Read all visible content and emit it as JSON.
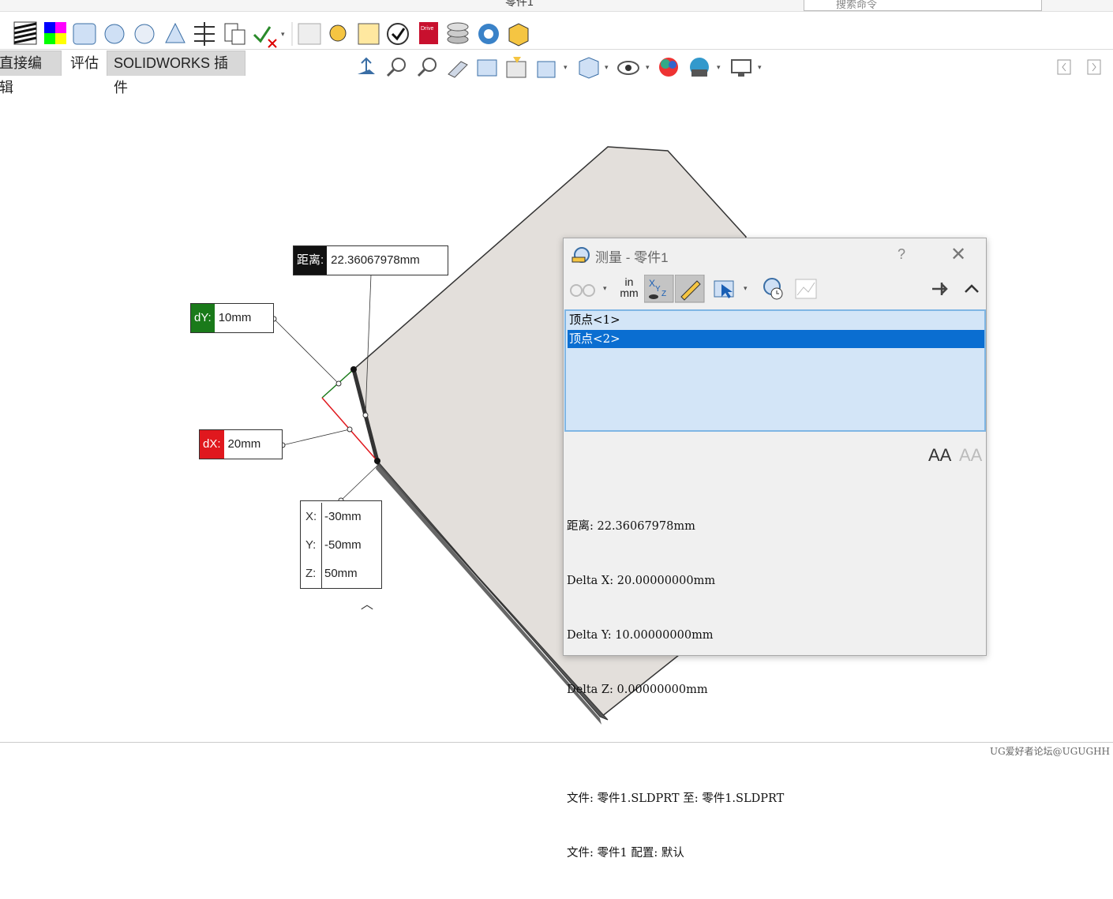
{
  "window": {
    "title": "零件1"
  },
  "search": {
    "placeholder": "搜索命令"
  },
  "tabs": [
    {
      "label": "直接编辑",
      "active": true
    },
    {
      "label": "评估",
      "active": false
    },
    {
      "label": "SOLIDWORKS 插件",
      "active": true
    }
  ],
  "toolbar_icons": [
    "zebra-stripes-icon",
    "curvature-icon",
    "deviation-analysis-icon",
    "draft-analysis-icon",
    "undercut-analysis-icon",
    "parting-line-icon",
    "thickness-icon",
    "interference-icon",
    "check-icon",
    "geometry-analysis-icon",
    "import-diagnostics-icon",
    "simulation-icon",
    "feature-check-icon",
    "driveworks-icon",
    "costing-icon",
    "sustainability-icon",
    "design-checker-icon"
  ],
  "view_icons": [
    "view-orientation-icon",
    "zoom-to-fit-icon",
    "zoom-area-icon",
    "previous-view-icon",
    "section-view-icon",
    "dynamic-annotation-icon",
    "view-orientation-icon",
    "display-style-icon",
    "hide-show-icon",
    "edit-appearance-icon",
    "scene-icon",
    "view-settings-icon"
  ],
  "callouts": {
    "distance": {
      "label": "距离:",
      "value": "22.36067978mm"
    },
    "dy": {
      "label": "dY:",
      "value": "10mm",
      "color": "#1a7a1a"
    },
    "dx": {
      "label": "dX:",
      "value": "20mm",
      "color": "#e0181e"
    },
    "coords": [
      {
        "axis": "X:",
        "value": "-30mm"
      },
      {
        "axis": "Y:",
        "value": "-50mm"
      },
      {
        "axis": "Z:",
        "value": "50mm"
      }
    ]
  },
  "measure_dialog": {
    "title": "测量 - 零件1",
    "help": "?",
    "close": "✕",
    "units_label_top": "in",
    "units_label_bottom": "mm",
    "selections": [
      {
        "label": "顶点<1>",
        "selected": false
      },
      {
        "label": "顶点<2>",
        "selected": true
      }
    ],
    "font_larger": "AA",
    "font_smaller": "AA",
    "results": [
      "距离: 22.36067978mm",
      "Delta X: 20.00000000mm",
      "Delta Y: 10.00000000mm",
      "Delta Z: 0.00000000mm",
      "",
      "文件: 零件1.SLDPRT 至: 零件1.SLDPRT",
      "文件: 零件1 配置: 默认"
    ]
  },
  "statusbar": {
    "watermark": "UG爱好者论坛@UGUGHH"
  },
  "colors": {
    "accent": "#0a6ed1",
    "list_bg": "#d3e5f7",
    "part_face": "#e3dfdb",
    "part_edge": "#555555"
  }
}
